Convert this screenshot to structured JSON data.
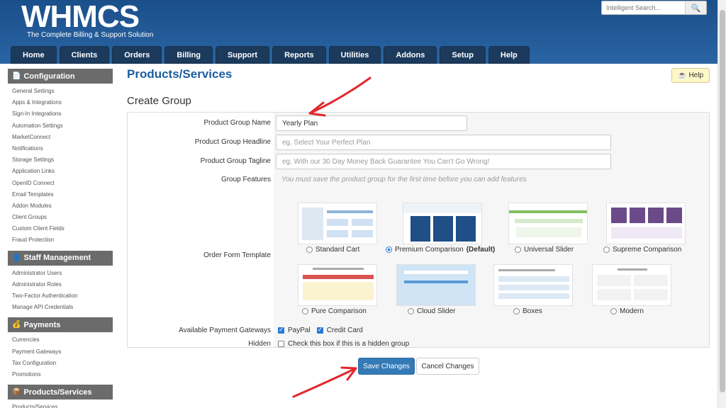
{
  "app": {
    "logo": "WHMCS",
    "tagline": "The Complete Billing & Support Solution",
    "search_placeholder": "Intelligent Search...",
    "accent": "#1c5da0"
  },
  "nav": [
    "Home",
    "Clients",
    "Orders",
    "Billing",
    "Support",
    "Reports",
    "Utilities",
    "Addons",
    "Setup",
    "Help"
  ],
  "sidebar": [
    {
      "title": "Configuration",
      "icon": "document-icon",
      "items": [
        "General Settings",
        "Apps & Integrations",
        "Sign-In Integrations",
        "Automation Settings",
        "MarketConnect",
        "Notifications",
        "Storage Settings",
        "Application Links",
        "OpenID Connect",
        "Email Templates",
        "Addon Modules",
        "Client Groups",
        "Custom Client Fields",
        "Fraud Protection"
      ]
    },
    {
      "title": "Staff Management",
      "icon": "staff-icon",
      "items": [
        "Administrator Users",
        "Administrator Roles",
        "Two-Factor Authentication",
        "Manage API Credentials"
      ]
    },
    {
      "title": "Payments",
      "icon": "payments-icon",
      "items": [
        "Currencies",
        "Payment Gateways",
        "Tax Configuration",
        "Promotions"
      ]
    },
    {
      "title": "Products/Services",
      "icon": "box-icon",
      "items": [
        "Products/Services"
      ]
    }
  ],
  "main": {
    "page_title": "Products/Services",
    "help_label": "Help",
    "section_title": "Create Group",
    "fields": {
      "name_label": "Product Group Name",
      "name_value": "Yearly Plan",
      "headline_label": "Product Group Headline",
      "headline_placeholder": "eg. Select Your Perfect Plan",
      "tagline_label": "Product Group Tagline",
      "tagline_placeholder": "eg. With our 30 Day Money Back Guarantee You Can't Go Wrong!",
      "features_label": "Group Features",
      "features_note": "You must save the product group for the first time before you can add features",
      "template_label": "Order Form Template",
      "gateways_label": "Available Payment Gateways",
      "gateway_paypal": "PayPal",
      "gateway_card": "Credit Card",
      "hidden_label": "Hidden",
      "hidden_text": "Check this box if this is a hidden group"
    },
    "templates": [
      {
        "name": "Standard Cart",
        "selected": false
      },
      {
        "name": "Premium Comparison",
        "suffix": "(Default)",
        "selected": true
      },
      {
        "name": "Universal Slider",
        "selected": false
      },
      {
        "name": "Supreme Comparison",
        "selected": false
      },
      {
        "name": "Pure Comparison",
        "selected": false
      },
      {
        "name": "Cloud Slider",
        "selected": false
      },
      {
        "name": "Boxes",
        "selected": false
      },
      {
        "name": "Modern",
        "selected": false
      }
    ],
    "save_label": "Save Changes",
    "cancel_label": "Cancel Changes"
  }
}
